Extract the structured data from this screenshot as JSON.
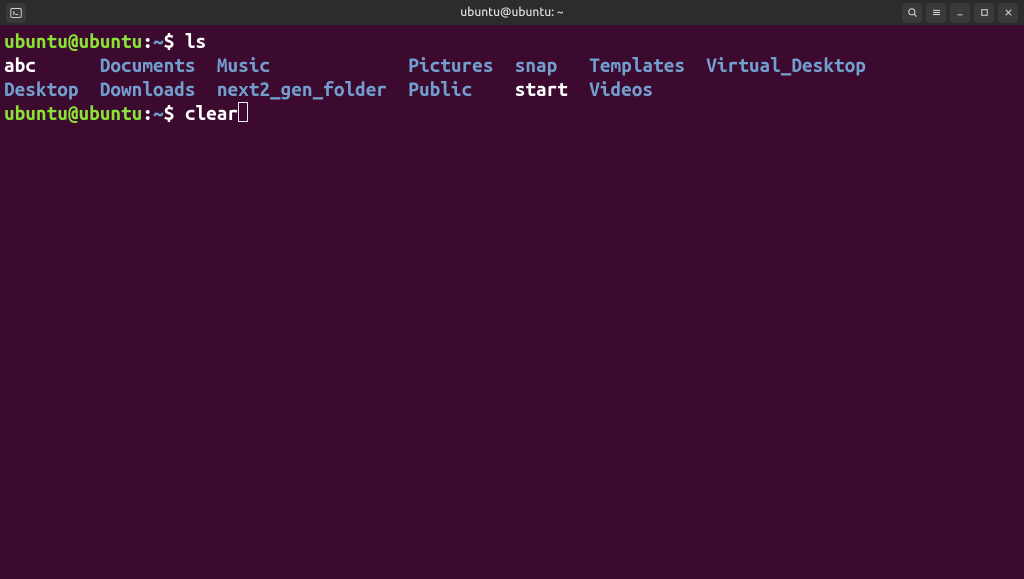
{
  "window": {
    "title": "ubuntu@ubuntu: ~"
  },
  "terminal": {
    "prompt": {
      "user_host": "ubuntu@ubuntu",
      "colon": ":",
      "path": "~",
      "dollar": "$"
    },
    "lines": [
      {
        "type": "prompt",
        "command": "ls"
      },
      {
        "type": "listing",
        "cells": [
          {
            "text": "abc",
            "kind": "file",
            "pad": 9
          },
          {
            "text": "Documents",
            "kind": "dir",
            "pad": 11
          },
          {
            "text": "Music",
            "kind": "dir",
            "pad": 18
          },
          {
            "text": "Pictures",
            "kind": "dir",
            "pad": 10
          },
          {
            "text": "snap",
            "kind": "dir",
            "pad": 7
          },
          {
            "text": "Templates",
            "kind": "dir",
            "pad": 11
          },
          {
            "text": "Virtual_Desktop",
            "kind": "dir",
            "pad": 0
          }
        ]
      },
      {
        "type": "listing",
        "cells": [
          {
            "text": "Desktop",
            "kind": "dir",
            "pad": 9
          },
          {
            "text": "Downloads",
            "kind": "dir",
            "pad": 11
          },
          {
            "text": "next2_gen_folder",
            "kind": "dir",
            "pad": 18
          },
          {
            "text": "Public",
            "kind": "dir",
            "pad": 10
          },
          {
            "text": "start",
            "kind": "file",
            "pad": 7
          },
          {
            "text": "Videos",
            "kind": "dir",
            "pad": 0
          }
        ]
      },
      {
        "type": "prompt",
        "command": "clear",
        "cursor": true
      }
    ]
  },
  "icons": {
    "terminal": "terminal-icon",
    "search": "search-icon",
    "menu": "menu-icon",
    "minimize": "minimize-icon",
    "maximize": "maximize-icon",
    "close": "close-icon"
  }
}
